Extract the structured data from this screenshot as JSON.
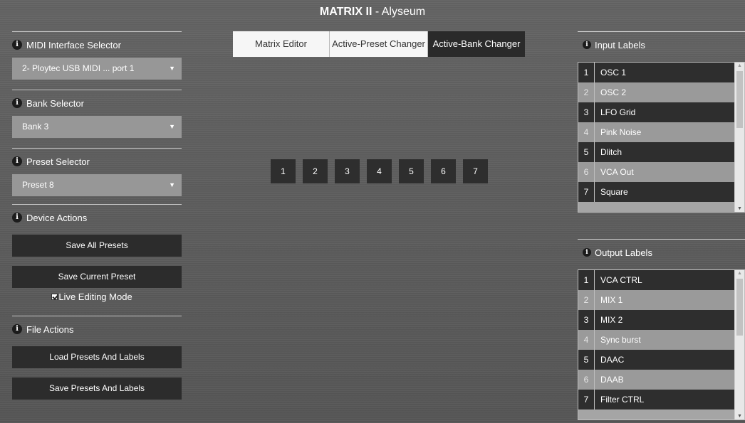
{
  "app": {
    "title_bold": "MATRIX II",
    "title_rest": " - Alyseum"
  },
  "left": {
    "midi": {
      "heading": "MIDI Interface Selector",
      "value": "2- Ploytec USB MIDI ... port 1"
    },
    "bank": {
      "heading": "Bank Selector",
      "value": "Bank 3"
    },
    "preset": {
      "heading": "Preset Selector",
      "value": "Preset 8"
    },
    "device": {
      "heading": "Device Actions",
      "save_all": "Save All Presets",
      "save_current": "Save Current Preset",
      "live_editing": "Live Editing Mode",
      "live_editing_checked": true
    },
    "file": {
      "heading": "File Actions",
      "load": "Load Presets And Labels",
      "save": "Save Presets And Labels"
    }
  },
  "tabs": [
    {
      "label": "Matrix Editor",
      "active": false
    },
    {
      "label": "Active-Preset Changer",
      "active": false
    },
    {
      "label": "Active-Bank Changer",
      "active": true
    }
  ],
  "banks": [
    "1",
    "2",
    "3",
    "4",
    "5",
    "6",
    "7"
  ],
  "input_labels": {
    "heading": "Input Labels",
    "rows": [
      {
        "num": "1",
        "label": "OSC 1"
      },
      {
        "num": "2",
        "label": "OSC 2"
      },
      {
        "num": "3",
        "label": "LFO Grid"
      },
      {
        "num": "4",
        "label": "Pink Noise"
      },
      {
        "num": "5",
        "label": "Dlitch"
      },
      {
        "num": "6",
        "label": "VCA Out"
      },
      {
        "num": "7",
        "label": "Square"
      }
    ]
  },
  "output_labels": {
    "heading": "Output Labels",
    "rows": [
      {
        "num": "1",
        "label": "VCA CTRL"
      },
      {
        "num": "2",
        "label": "MIX 1"
      },
      {
        "num": "3",
        "label": "MIX 2"
      },
      {
        "num": "4",
        "label": "Sync burst"
      },
      {
        "num": "5",
        "label": "DAAC"
      },
      {
        "num": "6",
        "label": "DAAB"
      },
      {
        "num": "7",
        "label": "Filter CTRL"
      }
    ]
  }
}
